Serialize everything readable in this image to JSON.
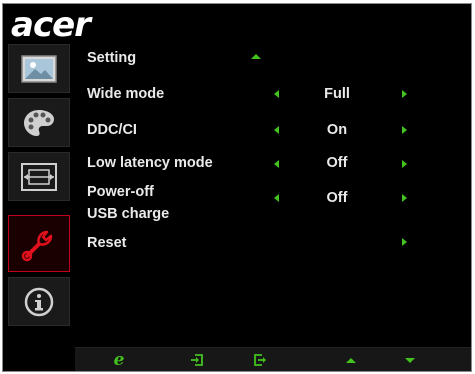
{
  "brand": "acer",
  "sidebar": {
    "items": [
      {
        "icon": "picture-icon"
      },
      {
        "icon": "color-palette-icon"
      },
      {
        "icon": "screen-size-icon"
      },
      {
        "icon": "wrench-icon",
        "active": true
      },
      {
        "icon": "info-icon"
      }
    ]
  },
  "menu": {
    "title": "Setting",
    "rows": [
      {
        "label": "Wide mode",
        "value": "Full"
      },
      {
        "label": "DDC/CI",
        "value": "On"
      },
      {
        "label": "Low latency mode",
        "value": "Off"
      },
      {
        "label_line1": "Power-off",
        "label_line2": "USB charge",
        "value": "Off"
      },
      {
        "label": "Reset"
      }
    ]
  },
  "footer": {
    "buttons": [
      {
        "icon": "e-mode-icon",
        "glyph": "e"
      },
      {
        "icon": "input-source-icon"
      },
      {
        "icon": "exit-icon"
      },
      {
        "icon": "up-arrow-icon"
      },
      {
        "icon": "down-arrow-icon"
      }
    ]
  },
  "colors": {
    "accent": "#44c21f",
    "active_border": "#c0001a",
    "background": "#000000",
    "text": "#eaeaea"
  }
}
